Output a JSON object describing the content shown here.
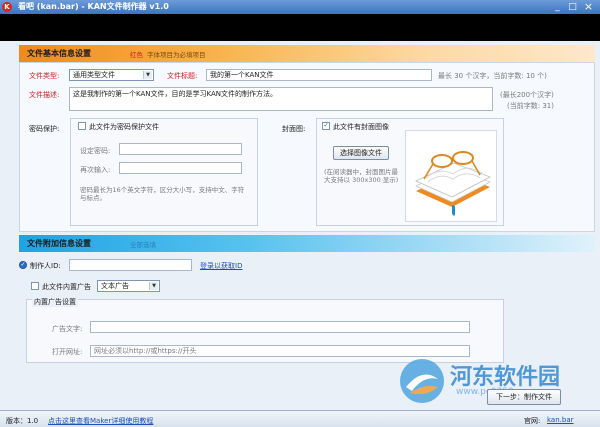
{
  "window": {
    "title": "看吧 (kan.bar) - KAN文件制作器 v1.0",
    "icon_text": "K",
    "minimize": "_",
    "maximize": "□",
    "close": "×"
  },
  "basic_section": {
    "title": "文件基本信息设置",
    "hint_red": "红色",
    "hint_rest": "字体项目为必填项目",
    "file_type_label": "文件类型:",
    "file_type_value": "通用类型文件",
    "file_title_label": "文件标题:",
    "file_title_value": "我的第一个KAN文件",
    "title_limit": "最长 30 个汉字，当前字数: 10 个)",
    "desc_label": "文件描述:",
    "desc_value": "这是我制作的第一个KAN文件，目的是学习KAN文件的制作方法。",
    "desc_limit": "(最长200个汉字)",
    "desc_count": "(当前字数: 31)",
    "password": {
      "label": "密码保护:",
      "checkbox_label": "此文件为密码保护文件",
      "checked": false,
      "pwd_label": "设定密码:",
      "pwd_value": "",
      "confirm_label": "再次输入:",
      "confirm_value": "",
      "note": "密码最长为16个英文字符，区分大小写，支持中文、字符与标点。"
    },
    "cover": {
      "label": "封面图:",
      "checkbox_label": "此文件有封面图像",
      "checked": true,
      "select_button": "选择图像文件",
      "note": "(在阅读器中，封面图片最大支持以 300x300 显示)"
    }
  },
  "extra_section": {
    "title": "文件附加信息设置",
    "hint": "全部选填",
    "author_id_label": "制作人ID:",
    "author_id_checked": true,
    "author_id_value": "",
    "login_link": "登录以获取ID",
    "ad_checkbox_label": "此文件内置广告",
    "ad_checked": false,
    "ad_type_value": "文本广告",
    "ad_group_title": "内置广告设置",
    "ad_text_label": "广告文字:",
    "ad_text_value": "",
    "ad_url_label": "打开网址:",
    "ad_url_placeholder": "网址必须以http://或https://开头"
  },
  "footer": {
    "next_button": "下一步：制作文件",
    "version_label": "版本：1.0",
    "help_link": "点击这里查看Maker详细使用教程",
    "site_label": "官网:",
    "site_link": "kan.bar"
  },
  "watermark": {
    "text": "河东软件园",
    "url": "www.pc0359.cn"
  },
  "colors": {
    "title_bar": "#3f73c2",
    "orange_header": "#f08a1c",
    "blue_header": "#1da3e4",
    "required_red": "#d01e1e",
    "link_blue": "#1d4fb5"
  }
}
